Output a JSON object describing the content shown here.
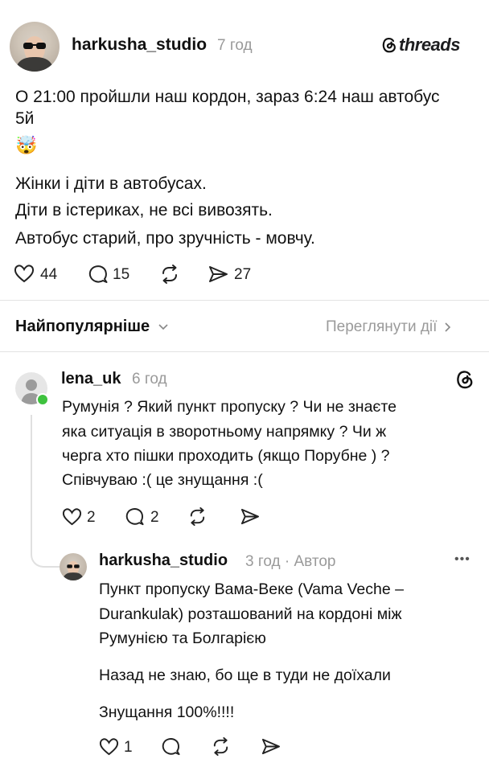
{
  "post": {
    "username": "harkusha_studio",
    "time": "7 год",
    "brand": "threads",
    "text_line1": "О 21:00 пройшли наш кордон, зараз 6:24 наш автобус",
    "text_line2": "5й",
    "emoji": "🤯",
    "text_line3": "Жінки і діти в автобусах.",
    "text_line4": "Діти в істериках, не всі вивозять.",
    "text_line5": "Автобус старий, про зручність - мовчу.",
    "likes": "44",
    "comments": "15",
    "shares": "27"
  },
  "sort": {
    "label": "Найпопулярніше",
    "view_activity": "Переглянути дії"
  },
  "reply1": {
    "username": "lena_uk",
    "time": "6 год",
    "line1": "Румунія ? Який пункт пропуску ? Чи не знаєте",
    "line2": "яка ситуація в зворотньому напрямку ? Чи ж",
    "line3": "черга хто пішки проходить (якщо Порубне ) ?",
    "line4": "Співчуваю :( це знущання :(",
    "likes": "2",
    "comments": "2"
  },
  "reply2": {
    "username": "harkusha_studio",
    "time": "3 год · Автор",
    "line1": "Пункт пропуску Вама-Веке (Vama Veche –",
    "line2": "Durankulak) розташований на кордоні між",
    "line3": "Румунією та Болгарією",
    "line4": "Назад не знаю, бо ще в туди не доїхали",
    "line5": "Знущання 100%!!!!",
    "likes": "1",
    "more": "•••"
  }
}
